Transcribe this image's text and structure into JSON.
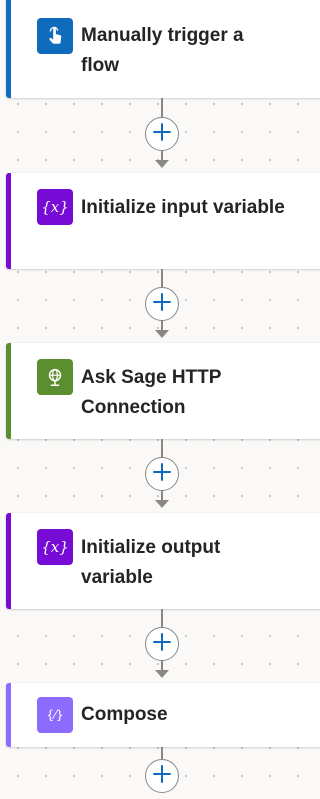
{
  "flow": {
    "steps": [
      {
        "title": "Manually trigger a flow",
        "icon": "touch-hand-icon",
        "accent": "#0f6cbd",
        "icon_bg": "#0f6cbd"
      },
      {
        "title": "Initialize input variable",
        "icon": "variable-icon",
        "accent": "#770bd6",
        "icon_bg": "#770bd6"
      },
      {
        "title": "Ask Sage HTTP Connection",
        "icon": "globe-connector-icon",
        "accent": "#5b8e2e",
        "icon_bg": "#5b8e2e"
      },
      {
        "title": "Initialize output variable",
        "icon": "variable-icon",
        "accent": "#770bd6",
        "icon_bg": "#770bd6"
      },
      {
        "title": "Compose",
        "icon": "compose-icon",
        "accent": "#8c6cff",
        "icon_bg": "#8c6cff"
      }
    ],
    "add_action_icon": "plus-icon",
    "colors": {
      "connector": "#8a8886",
      "plus": "#0f6cbd",
      "canvas": "#faf9f8"
    }
  }
}
